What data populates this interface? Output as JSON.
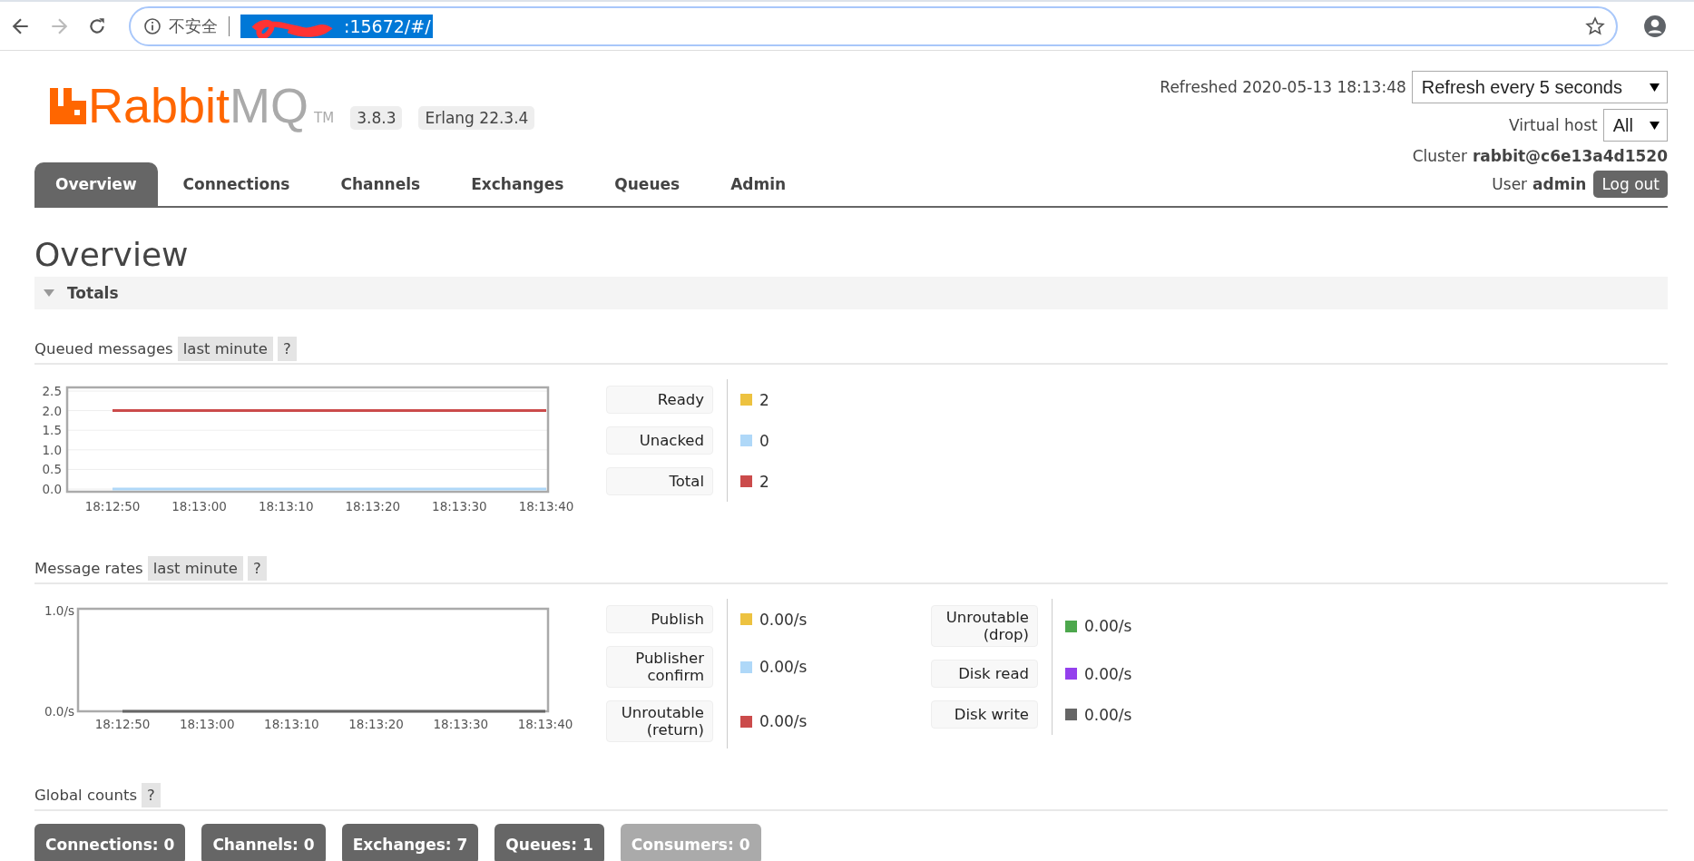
{
  "browser": {
    "security_label": "不安全",
    "url": ":15672/#/"
  },
  "header": {
    "logo_primary": "Rabbit",
    "logo_secondary": "MQ",
    "trademark": "TM",
    "version": "3.8.3",
    "erlang": "Erlang 22.3.4",
    "refreshed": "Refreshed 2020-05-13 18:13:48",
    "refresh_select": "Refresh every 5 seconds",
    "vhost_label": "Virtual host",
    "vhost_select": "All",
    "cluster_label": "Cluster",
    "cluster": "rabbit@c6e13a4d1520",
    "user_label": "User",
    "user": "admin",
    "logout": "Log out"
  },
  "tabs": [
    {
      "label": "Overview",
      "selected": true
    },
    {
      "label": "Connections",
      "selected": false
    },
    {
      "label": "Channels",
      "selected": false
    },
    {
      "label": "Exchanges",
      "selected": false
    },
    {
      "label": "Queues",
      "selected": false
    },
    {
      "label": "Admin",
      "selected": false
    }
  ],
  "page_title": "Overview",
  "section": {
    "title": "Totals",
    "expanded": true
  },
  "queued": {
    "title": "Queued messages",
    "range": "last minute",
    "help": "?",
    "chart_data": {
      "type": "line",
      "grid": true,
      "x": [
        "18:12:50",
        "18:13:00",
        "18:13:10",
        "18:13:20",
        "18:13:30",
        "18:13:40"
      ],
      "ylim": [
        0,
        2.5
      ],
      "yticks": [
        {
          "value": 0,
          "label": "0.0"
        },
        {
          "value": 0.5,
          "label": "0.5"
        },
        {
          "value": 1,
          "label": "1.0"
        },
        {
          "value": 1.5,
          "label": "1.5"
        },
        {
          "value": 2,
          "label": "2.0"
        },
        {
          "value": 2.5,
          "label": "2.5"
        }
      ],
      "series": [
        {
          "name": "Ready",
          "color": "#edc240",
          "values": [
            null,
            null,
            null,
            null,
            null,
            null
          ]
        },
        {
          "name": "Unacked",
          "color": "#afd8f8",
          "values": [
            0,
            0,
            0,
            0,
            0,
            0
          ]
        },
        {
          "name": "Total",
          "color": "#cb4b4b",
          "values": [
            2,
            2,
            2,
            2,
            2,
            2
          ]
        }
      ]
    },
    "legend": [
      {
        "value": "2"
      },
      {
        "value": "0"
      },
      {
        "value": "2"
      }
    ]
  },
  "rates": {
    "title": "Message rates",
    "range": "last minute",
    "help": "?",
    "chart_data": {
      "type": "line",
      "x": [
        "18:12:50",
        "18:13:00",
        "18:13:10",
        "18:13:20",
        "18:13:30",
        "18:13:40"
      ],
      "ylim": [
        0,
        1
      ],
      "yticks": [
        {
          "value": 0,
          "label": "0.0/s"
        },
        {
          "value": 1,
          "label": "1.0/s"
        }
      ],
      "series": [
        {
          "name": "Publish",
          "color": "#edc240",
          "values": [
            null,
            null,
            null,
            null,
            null,
            null
          ]
        },
        {
          "name": "Publisher confirm",
          "color": "#afd8f8",
          "values": [
            null,
            null,
            null,
            null,
            null,
            null
          ]
        },
        {
          "name": "Unroutable (return)",
          "color": "#cb4b4b",
          "values": [
            null,
            null,
            null,
            null,
            null,
            null
          ]
        },
        {
          "name": "Unroutable (drop)",
          "color": "#4da74d",
          "values": [
            null,
            null,
            null,
            null,
            null,
            null
          ]
        },
        {
          "name": "Disk read",
          "color": "#9440ed",
          "values": [
            null,
            null,
            null,
            null,
            null,
            null
          ]
        },
        {
          "name": "Disk write",
          "color": "#666666",
          "values": [
            0,
            0,
            0,
            0,
            0,
            0
          ]
        }
      ]
    },
    "legend": [
      {
        "value": "0.00/s"
      },
      {
        "value": "0.00/s"
      },
      {
        "value": "0.00/s"
      },
      {
        "value": "0.00/s"
      },
      {
        "value": "0.00/s"
      },
      {
        "value": "0.00/s"
      }
    ]
  },
  "global": {
    "title": "Global counts",
    "help": "?",
    "counts": [
      {
        "label": "Connections: 0",
        "muted": false
      },
      {
        "label": "Channels: 0",
        "muted": false
      },
      {
        "label": "Exchanges: 7",
        "muted": false
      },
      {
        "label": "Queues: 1",
        "muted": false
      },
      {
        "label": "Consumers: 0",
        "muted": true
      }
    ]
  }
}
